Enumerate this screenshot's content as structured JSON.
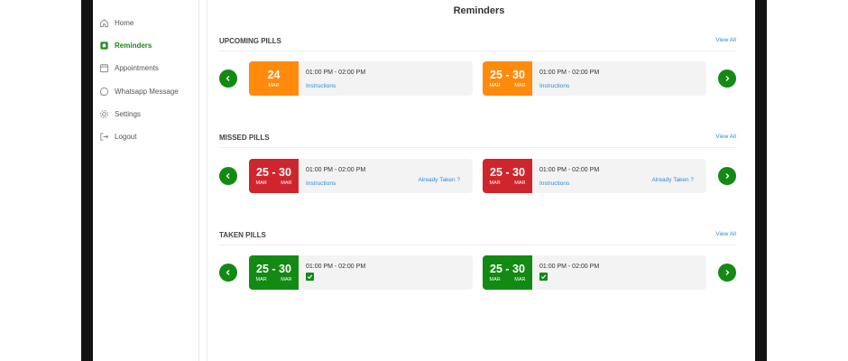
{
  "sidebar": {
    "items": [
      {
        "label": "Home",
        "icon": "home-icon",
        "active": false
      },
      {
        "label": "Reminders",
        "icon": "reminder-icon",
        "active": true
      },
      {
        "label": "Appointments",
        "icon": "calendar-icon",
        "active": false
      },
      {
        "label": "Whatsapp Message",
        "icon": "whatsapp-icon",
        "active": false
      },
      {
        "label": "Settings",
        "icon": "gear-icon",
        "active": false
      },
      {
        "label": "Logout",
        "icon": "logout-icon",
        "active": false
      }
    ]
  },
  "page": {
    "title": "Reminders"
  },
  "colors": {
    "accent": "#138a13",
    "orange": "#ff8a0c",
    "red": "#cf262e",
    "link": "#2b8fd6"
  },
  "sections": {
    "upcoming": {
      "title": "UPCOMING PILLS",
      "view_all": "View All",
      "cards": [
        {
          "date": "24",
          "months": [
            "MAR"
          ],
          "time": "01:00 PM - 02:00 PM",
          "link": "Instructions"
        },
        {
          "date": "25 - 30",
          "months": [
            "MAR",
            "MAR"
          ],
          "time": "01:00 PM - 02:00 PM",
          "link": "Instructions"
        }
      ]
    },
    "missed": {
      "title": "MISSED PILLS",
      "view_all": "View All",
      "cards": [
        {
          "date": "25 - 30",
          "months": [
            "MAR",
            "MAR"
          ],
          "time": "01:00 PM - 02:00 PM",
          "link": "Instructions",
          "action": "Already Taken ?"
        },
        {
          "date": "25 - 30",
          "months": [
            "MAR",
            "MAR"
          ],
          "time": "01:00 PM - 02:00 PM",
          "link": "Instructions",
          "action": "Already Taken ?"
        }
      ]
    },
    "taken": {
      "title": "TAKEN PILLS",
      "view_all": "View All",
      "cards": [
        {
          "date": "25 - 30",
          "months": [
            "MAR",
            "MAR"
          ],
          "time": "01:00 PM - 02:00 PM",
          "checked": true
        },
        {
          "date": "25 - 30",
          "months": [
            "MAR",
            "MAR"
          ],
          "time": "01:00 PM - 02:00 PM",
          "checked": true
        }
      ]
    }
  }
}
